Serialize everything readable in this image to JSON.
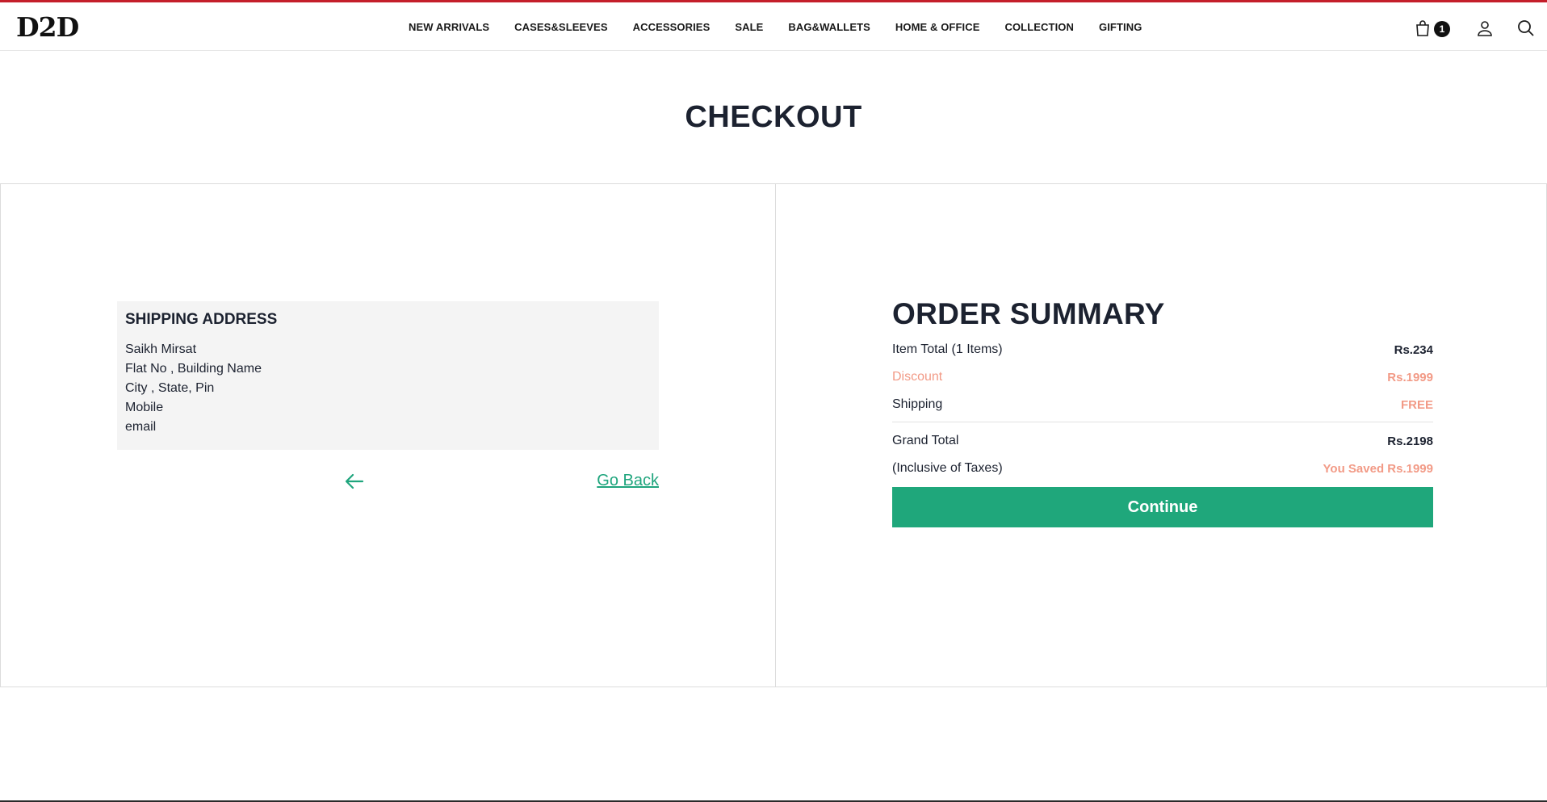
{
  "header": {
    "logo": "D2D",
    "nav": [
      "NEW ARRIVALS",
      "CASES&SLEEVES",
      "ACCESSORIES",
      "SALE",
      "BAG&WALLETS",
      "HOME & OFFICE",
      "COLLECTION",
      "GIFTING"
    ],
    "cart_count": "1",
    "icons": [
      "bag-icon",
      "user-icon",
      "search-icon"
    ]
  },
  "page": {
    "title": "CHECKOUT"
  },
  "shipping": {
    "title": "SHIPPING ADDRESS",
    "lines": [
      "Saikh Mirsat",
      "Flat No , Building Name",
      "City , State, Pin",
      "Mobile",
      "email"
    ],
    "back_label": "Go Back"
  },
  "summary": {
    "title": "ORDER SUMMARY",
    "item_total_label": "Item Total (1 Items)",
    "item_total_value": "Rs.234",
    "discount_label": "Discount",
    "discount_value": "Rs.1999",
    "shipping_label": "Shipping",
    "shipping_value": "FREE",
    "grand_total_label": "Grand Total",
    "grand_total_value": "Rs.2198",
    "taxes_label": "(Inclusive of Taxes)",
    "saved_value": "You Saved Rs.1999",
    "continue_label": "Continue"
  },
  "colors": {
    "accent": "#1fa77b",
    "discount": "#f29a86",
    "top_stripe": "#c41e2a"
  }
}
